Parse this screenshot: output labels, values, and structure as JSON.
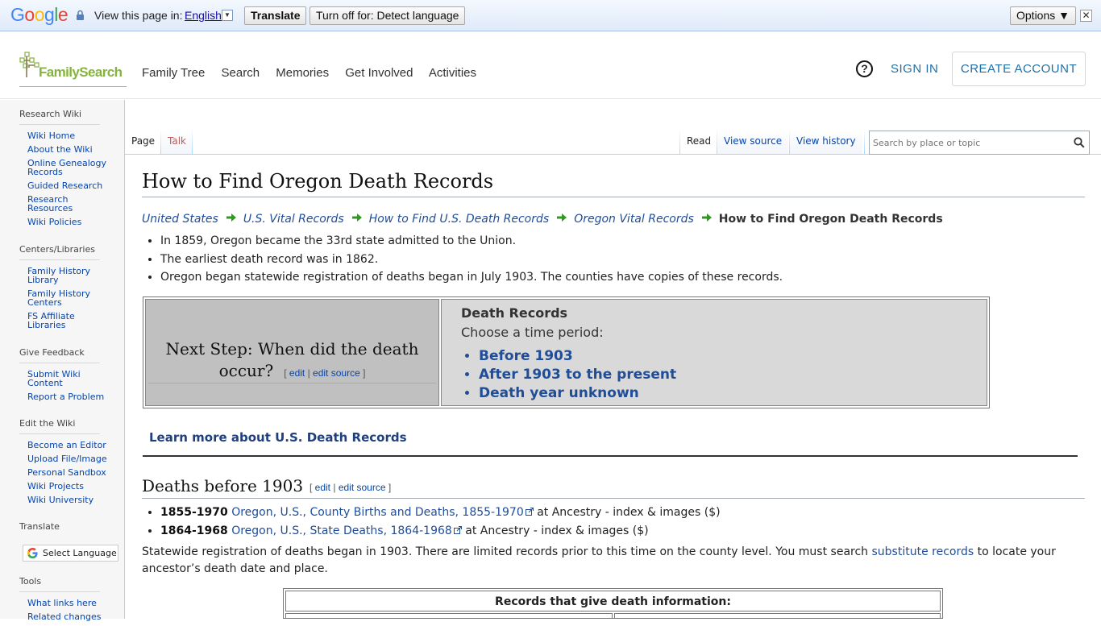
{
  "translate_bar": {
    "view_label": "View this page in:",
    "language": "English",
    "translate_button": "Translate",
    "turn_off_button": "Turn off for: Detect language",
    "options_button": "Options ▼",
    "close": "✕"
  },
  "header": {
    "logo_text": "FamilySearch",
    "nav": [
      "Family Tree",
      "Search",
      "Memories",
      "Get Involved",
      "Activities"
    ],
    "help": "?",
    "sign_in": "SIGN IN",
    "create_account": "CREATE ACCOUNT"
  },
  "sidebar": {
    "sections": [
      {
        "title": "Research Wiki",
        "items": [
          "Wiki Home",
          "About the Wiki",
          "Online Genealogy Records",
          "Guided Research",
          "Research Resources",
          "Wiki Policies"
        ]
      },
      {
        "title": "Centers/Libraries",
        "items": [
          "Family History Library",
          "Family History Centers",
          "FS Affiliate Libraries"
        ]
      },
      {
        "title": "Give Feedback",
        "items": [
          "Submit Wiki Content",
          "Report a Problem"
        ]
      },
      {
        "title": "Edit the Wiki",
        "items": [
          "Become an Editor",
          "Upload File/Image",
          "Personal Sandbox",
          "Wiki Projects",
          "Wiki University"
        ]
      },
      {
        "title": "Translate",
        "items": []
      },
      {
        "title": "Tools",
        "items": [
          "What links here",
          "Related changes"
        ]
      }
    ],
    "select_language": "Select Language"
  },
  "tabs": {
    "page": "Page",
    "talk": "Talk",
    "read": "Read",
    "view_source": "View source",
    "view_history": "View history"
  },
  "search": {
    "placeholder": "Search by place or topic"
  },
  "content": {
    "title": "How to Find Oregon Death Records",
    "breadcrumbs": [
      "United States",
      "U.S. Vital Records",
      "How to Find U.S. Death Records",
      "Oregon Vital Records"
    ],
    "breadcrumb_current": "How to Find Oregon Death Records",
    "intro_bullets": [
      "In 1859, Oregon became the 33rd state admitted to the Union.",
      "The earliest death record was in 1862.",
      "Oregon began statewide registration of deaths began in July 1903. The counties have copies of these records."
    ],
    "next_step": {
      "question": "Next Step: When did the death occur?",
      "edit": "edit",
      "edit_source": "edit source",
      "heading": "Death Records",
      "subheading": "Choose a time period:",
      "options": [
        "Before 1903",
        "After 1903 to the present",
        "Death year unknown"
      ]
    },
    "learn_more": "Learn more about U.S. Death Records",
    "section_heading": "Deaths before 1903",
    "section_edit": "edit",
    "section_edit_source": "edit source",
    "records": [
      {
        "years": "1855-1970",
        "link": "Oregon, U.S., County Births and Deaths, 1855-1970",
        "suffix": " at Ancestry - index & images ($)"
      },
      {
        "years": "1864-1968",
        "link": "Oregon, U.S., State Deaths, 1864-1968",
        "suffix": " at Ancestry - index & images ($)"
      }
    ],
    "paragraph_before": "Statewide registration of deaths began in 1903. There are limited records prior to this time on the county level. You must search ",
    "paragraph_link": "substitute records",
    "paragraph_after": " to locate your ancestor’s death date and place.",
    "table_caption": "Records that give death information:"
  }
}
